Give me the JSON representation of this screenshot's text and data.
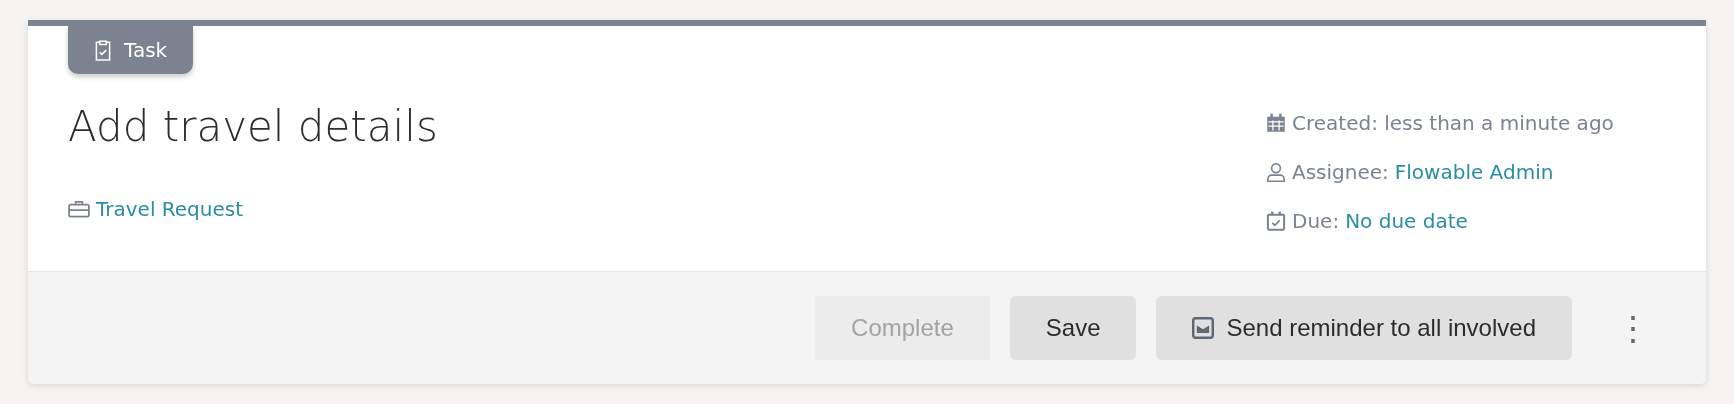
{
  "badge": {
    "label": "Task"
  },
  "title": "Add travel details",
  "case_link": "Travel Request",
  "meta": [
    {
      "kind": "created",
      "label": "Created: less than a minute ago"
    },
    {
      "kind": "assignee",
      "label": "Assignee:",
      "value": "Flowable Admin"
    },
    {
      "kind": "due",
      "label": "Due:",
      "value": "No due date"
    }
  ],
  "buttons": [
    {
      "kind": "plain",
      "label": "Complete",
      "disabled": true
    },
    {
      "kind": "plain",
      "label": "Save",
      "disabled": false
    },
    {
      "kind": "reminder",
      "label": "Send reminder to all involved",
      "disabled": false
    }
  ],
  "more_menu": "⋮"
}
